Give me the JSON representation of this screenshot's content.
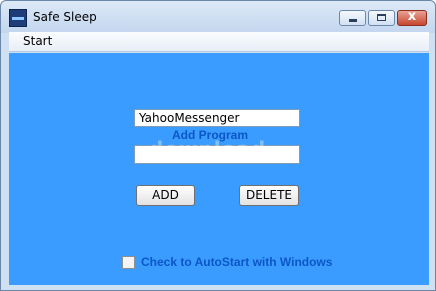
{
  "window": {
    "title": "Safe Sleep",
    "close_glyph": "x"
  },
  "menu": {
    "items": [
      "Start"
    ]
  },
  "form": {
    "program_value": "YahooMessenger",
    "second_value": "",
    "add_program_label": "Add Program",
    "add_button": "ADD",
    "delete_button": "DELETE",
    "autostart_label": "Check to AutoStart with Windows",
    "autostart_checked": false
  },
  "watermark": "download",
  "colors": {
    "client_background": "#3b9cff",
    "label_text": "#0b57c4"
  },
  "icons": {
    "app": "app-icon",
    "minimize": "minimize-icon",
    "maximize": "maximize-icon",
    "close": "close-icon"
  }
}
